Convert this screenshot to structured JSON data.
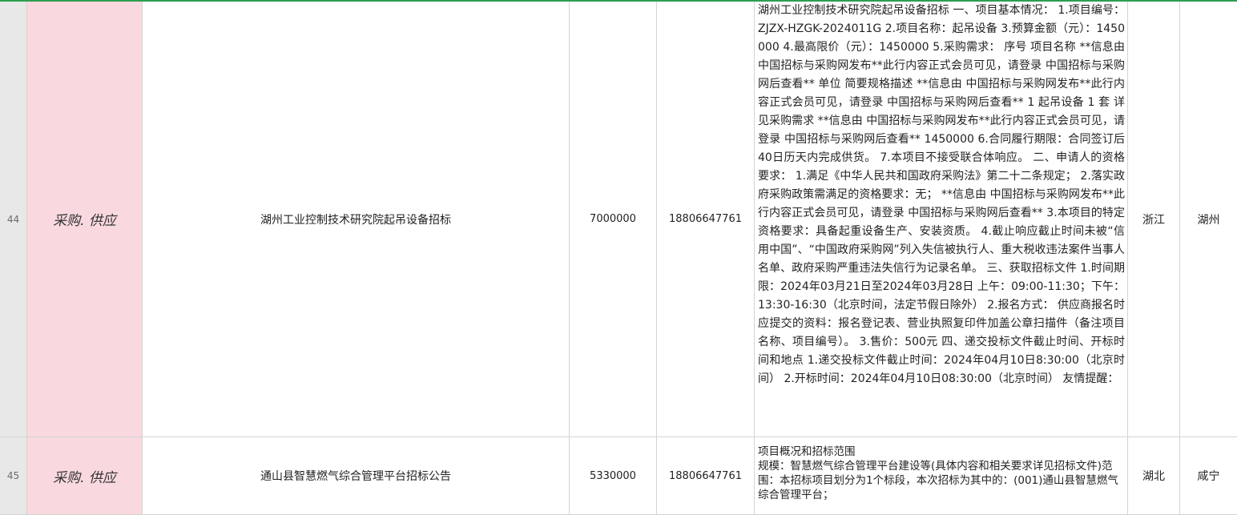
{
  "rows": [
    {
      "num": "44",
      "category": "采购. 供应",
      "title": "湖州工业控制技术研究院起吊设备招标",
      "amount": "7000000",
      "phone": "18806647761",
      "description": "湖州工业控制技术研究院起吊设备招标 一、项目基本情况： 1.项目编号：ZJZX-HZGK-2024011G 2.项目名称：起吊设备 3.预算金额（元）：1450000 4.最高限价（元）：1450000 5.采购需求： 序号 项目名称 **信息由 中国招标与采购网发布**此行内容正式会员可见，请登录 中国招标与采购网后查看** 单位 简要规格描述 **信息由 中国招标与采购网发布**此行内容正式会员可见，请登录 中国招标与采购网后查看** 1 起吊设备 1 套 详见采购需求 **信息由 中国招标与采购网发布**此行内容正式会员可见，请登录 中国招标与采购网后查看** 1450000 6.合同履行期限：合同签订后40日历天内完成供货。 7.本项目不接受联合体响应。 二、申请人的资格要求： 1.满足《中华人民共和国政府采购法》第二十二条规定； 2.落实政府采购政策需满足的资格要求：无； **信息由 中国招标与采购网发布**此行内容正式会员可见，请登录 中国招标与采购网后查看** 3.本项目的特定资格要求：具备起重设备生产、安装资质。 4.截止响应截止时间未被“信用中国”、“中国政府采购网”列入失信被执行人、重大税收违法案件当事人名单、政府采购严重违法失信行为记录名单。 三、获取招标文件 1.时间期限：2024年03月21日至2024年03月28日 上午：09:00-11:30；下午：13:30-16:30（北京时间，法定节假日除外） 2.报名方式： 供应商报名时应提交的资料：报名登记表、营业执照复印件加盖公章扫描件（备注项目名称、项目编号）。 3.售价：500元 四、递交投标文件截止时间、开标时间和地点 1.递交投标文件截止时间：2024年04月10日8:30:00（北京时间） 2.开标时间：2024年04月10日08:30:00（北京时间） 友情提醒：",
      "province": "浙江",
      "city": "湖州"
    },
    {
      "num": "45",
      "category": "采购. 供应",
      "title": "通山县智慧燃气综合管理平台招标公告",
      "amount": "5330000",
      "phone": "18806647761",
      "description": "项目概况和招标范围\n规模：智慧燃气综合管理平台建设等(具体内容和相关要求详见招标文件)范围：本招标项目划分为1个标段，本次招标为其中的：(001)通山县智慧燃气综合管理平台；",
      "province": "湖北",
      "city": "咸宁"
    }
  ]
}
